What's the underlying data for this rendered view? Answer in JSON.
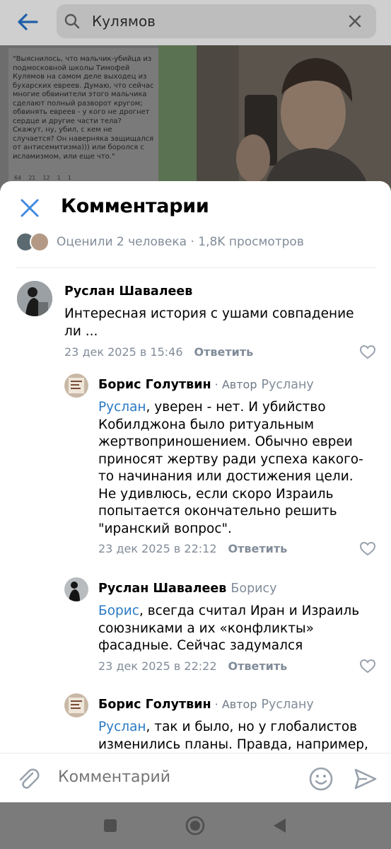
{
  "search": {
    "query": "Кулямов"
  },
  "post": {
    "quote_text": "\"Выяснилось, что мальчик-убийца из подмосковной школы Тимофей Кулямов на самом деле выходец из бухарских евреев. Думаю, что сейчас многие обвинители этого мальчика сделают полный разворот кругом; обвинять евреев - у кого не дрогнет сердце и другие части тела? Скажут, ну, убил, с кем не случается? Он наверняка защищался от антисемитизма))) или боролся с исламизмом, или еще что.\"",
    "reactions": [
      "64",
      "21",
      "12",
      "1",
      "1"
    ]
  },
  "sheet": {
    "title": "Комментарии",
    "stats": "Оценили 2 человека · 1,8K просмотров"
  },
  "comments": [
    {
      "author": "Руслан Шавалеев",
      "text": "Интересная история с ушами совпадение ли ...",
      "date": "23 дек 2025 в 15:46",
      "reply_label": "Ответить"
    },
    {
      "author": "Борис Голутвин",
      "role": " · Автор",
      "reply_to": "Руслану",
      "mention": "Руслан",
      "text": ", уверен - нет. И убийство Кобилджона было ритуальным жертвоприношением. Обычно евреи приносят жертву ради успеха какого-то начинания или достижения цели. Не удивлюсь, если скоро Израиль попытается окончательно решить \"иранский вопрос\".",
      "date": "23 дек 2025 в 22:12",
      "reply_label": "Ответить"
    },
    {
      "author": "Руслан Шавалеев",
      "reply_to": "Борису",
      "mention": "Борис",
      "text": ", всегда считал Иран и Израиль союзниками а их «конфликты» фасадные. Сейчас задумался",
      "date": "23 дек 2025 в 22:22",
      "reply_label": "Ответить"
    },
    {
      "author": "Борис Голутвин",
      "role": " · Автор",
      "reply_to": "Руслану",
      "mention": "Руслан",
      "text": ", так и было, но у глобалистов изменились планы. Правда, например,"
    }
  ],
  "composer": {
    "placeholder": "Комментарий"
  },
  "colors": {
    "link": "#2a7ac4",
    "secondary": "#818c99",
    "accent_blue": "#3f8ae0"
  },
  "icons": [
    "back-arrow-icon",
    "search-icon",
    "clear-icon",
    "close-icon",
    "heart-icon",
    "paperclip-icon",
    "smile-icon",
    "send-icon"
  ]
}
